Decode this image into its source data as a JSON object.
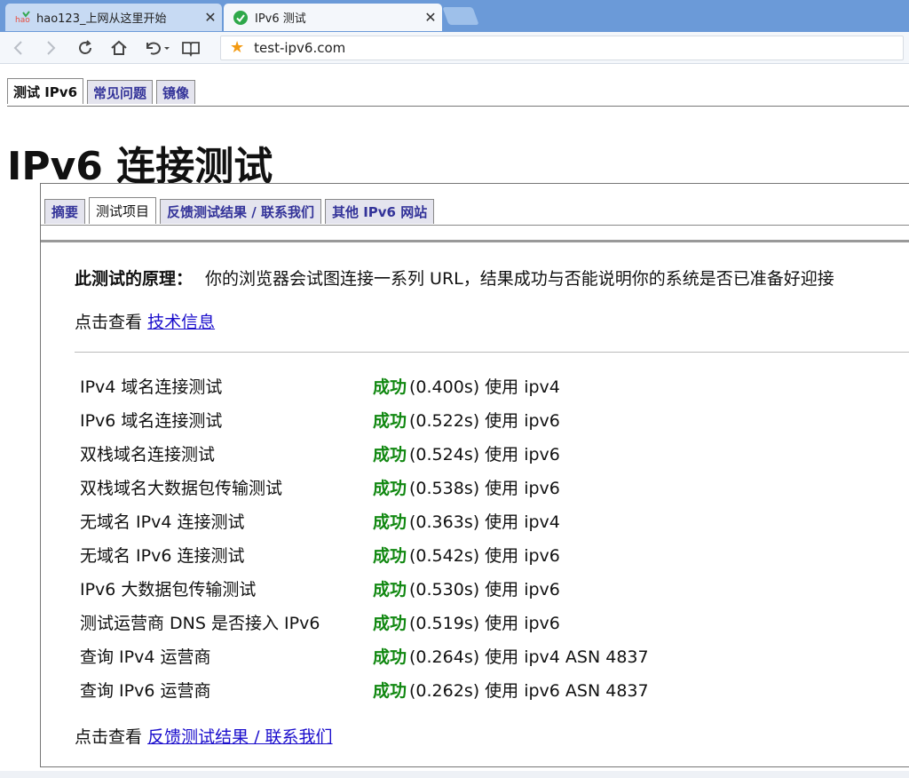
{
  "browser": {
    "tabs": [
      {
        "title": "hao123_上网从这里开始",
        "icon": "hao123-logo-icon"
      },
      {
        "title": "IPv6 测试",
        "icon": "check-circle-icon"
      }
    ],
    "url": "test-ipv6.com"
  },
  "site_nav": [
    "测试 IPv6",
    "常见问题",
    "镜像"
  ],
  "page": {
    "title": "IPv6 连接测试",
    "tabs": [
      "摘要",
      "测试项目",
      "反馈测试结果 / 联系我们",
      "其他 IPv6 网站"
    ],
    "principle_label": "此测试的原理：",
    "principle_text": "你的浏览器会试图连接一系列 URL，结果成功与否能说明你的系统是否已准备好迎接",
    "info_prefix": "点击查看",
    "info_link": "技术信息",
    "results": [
      {
        "name": "IPv4 域名连接测试",
        "status": "成功",
        "detail": "(0.400s) 使用 ipv4"
      },
      {
        "name": "IPv6 域名连接测试",
        "status": "成功",
        "detail": "(0.522s) 使用 ipv6"
      },
      {
        "name": "双栈域名连接测试",
        "status": "成功",
        "detail": "(0.524s) 使用 ipv6"
      },
      {
        "name": "双栈域名大数据包传输测试",
        "status": "成功",
        "detail": "(0.538s) 使用 ipv6"
      },
      {
        "name": "无域名 IPv4 连接测试",
        "status": "成功",
        "detail": "(0.363s) 使用 ipv4"
      },
      {
        "name": "无域名 IPv6 连接测试",
        "status": "成功",
        "detail": "(0.542s) 使用 ipv6"
      },
      {
        "name": "IPv6 大数据包传输测试",
        "status": "成功",
        "detail": "(0.530s) 使用 ipv6"
      },
      {
        "name": "测试运营商 DNS 是否接入 IPv6",
        "status": "成功",
        "detail": "(0.519s) 使用 ipv6"
      },
      {
        "name": "查询 IPv4 运营商",
        "status": "成功",
        "detail": "(0.264s) 使用 ipv4 ASN 4837"
      },
      {
        "name": "查询 IPv6 运营商",
        "status": "成功",
        "detail": "(0.262s) 使用 ipv6 ASN 4837"
      }
    ],
    "feedback_prefix": "点击查看",
    "feedback_link": "反馈测试结果 / 联系我们"
  },
  "colors": {
    "success": "#118811",
    "link": "#1a0dcc",
    "tab_text": "#333399",
    "titlebar": "#6b9ad8"
  }
}
